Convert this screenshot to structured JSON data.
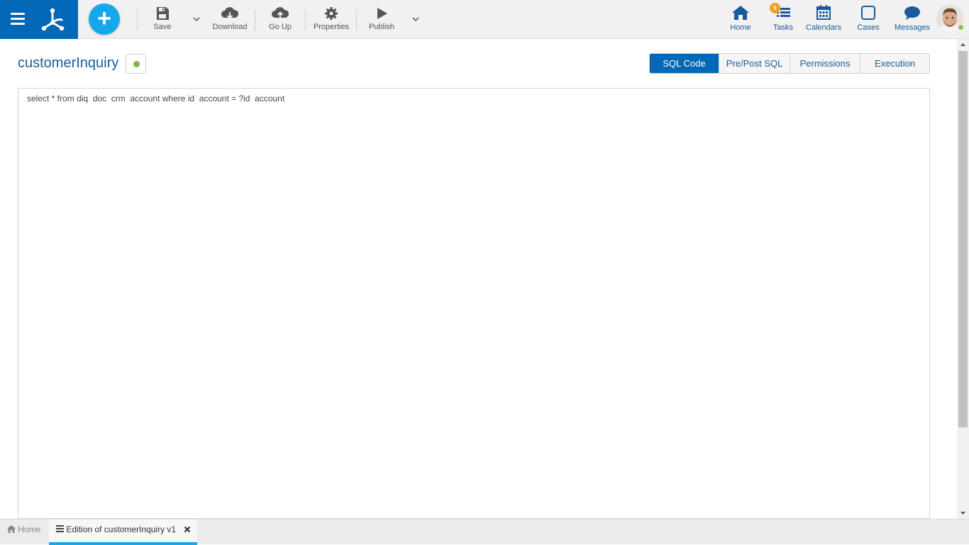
{
  "toolbar": {
    "save": "Save",
    "download": "Download",
    "go_up": "Go Up",
    "properties": "Properties",
    "publish": "Publish"
  },
  "nav": {
    "home": "Home",
    "tasks": "Tasks",
    "tasks_badge": "9",
    "calendars": "Calendars",
    "cases": "Cases",
    "messages": "Messages"
  },
  "page": {
    "title": "customerInquiry",
    "status_color": "#7db540"
  },
  "tabs": [
    "SQL Code",
    "Pre/Post SQL",
    "Permissions",
    "Execution"
  ],
  "active_tab": "SQL Code",
  "editor": {
    "code": "select * from diq  doc  crm  account where id  account = ?id  account"
  },
  "bottom_tabs": {
    "home": "Home",
    "edit": "Edition of customerInquiry v1"
  },
  "colors": {
    "brand": "#0068b5",
    "accent": "#16a7ec",
    "link": "#1a5a9c"
  }
}
